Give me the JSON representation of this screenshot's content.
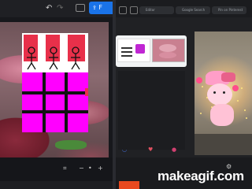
{
  "left_toolbar": {
    "undo_icon": "undo-icon",
    "redo_icon": "redo-icon",
    "more_icon": "more-icon",
    "primary_button_label": "F"
  },
  "right_tabs": [
    {
      "label": "Editor"
    },
    {
      "label": "Google Search"
    },
    {
      "label": "Pin on Pinterest"
    }
  ],
  "preview_panel": {
    "caption": "makeagif.com"
  },
  "watermark": "makeagif.com",
  "colors": {
    "accent_blue": "#1a73e8",
    "magenta": "#ff00ff",
    "sticker_red": "#e8304a",
    "pink": "#ff9ec8"
  }
}
